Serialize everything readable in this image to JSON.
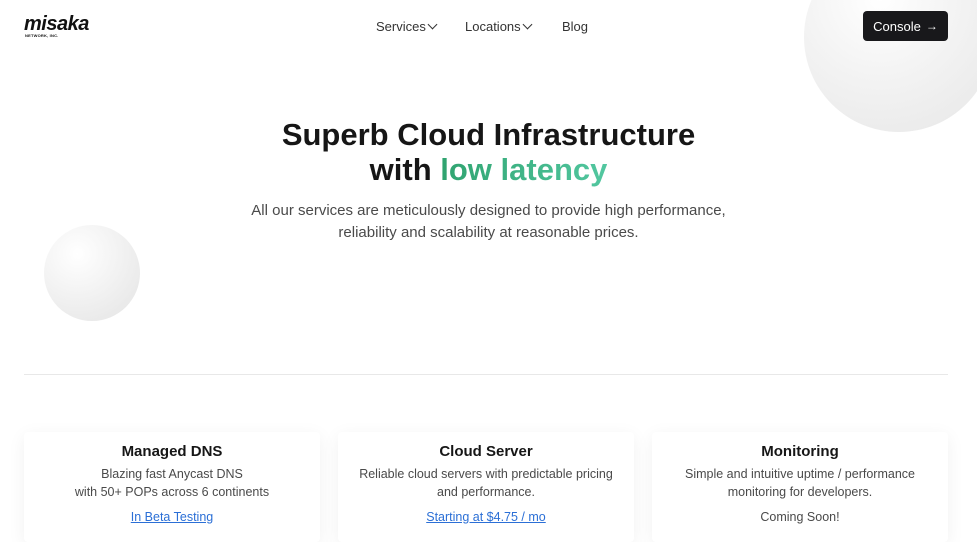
{
  "brand": {
    "name": "misaka",
    "subtitle": "NETWORK, INC."
  },
  "nav": {
    "items": [
      {
        "label": "Services",
        "dropdown": true
      },
      {
        "label": "Locations",
        "dropdown": true
      },
      {
        "label": "Blog",
        "dropdown": false
      }
    ],
    "console_label": "Console",
    "console_arrow": "→"
  },
  "hero": {
    "title_line1": "Superb Cloud Infrastructure",
    "title_line2_plain": "with ",
    "title_line2_accent": "low latency",
    "subtitle_line1": "All our services are meticulously designed to provide high performance,",
    "subtitle_line2": "reliability and scalability at reasonable prices."
  },
  "cards": [
    {
      "title": "Managed DNS",
      "desc_line1": "Blazing fast Anycast DNS",
      "desc_line2": "with 50+ POPs across 6 continents",
      "status": "In Beta Testing"
    },
    {
      "title": "Cloud Server",
      "desc_line1": "Reliable cloud servers with predictable pricing",
      "desc_line2": "and performance.",
      "status": "Starting at $4.75 / mo"
    },
    {
      "title": "Monitoring",
      "desc_line1": "Simple and intuitive uptime / performance",
      "desc_line2": "monitoring for developers.",
      "status": "Coming Soon!"
    }
  ],
  "colors": {
    "accent_start": "#2fa36f",
    "accent_end": "#52c7a0",
    "button_bg": "#18181b",
    "link": "#2b6fd6"
  }
}
